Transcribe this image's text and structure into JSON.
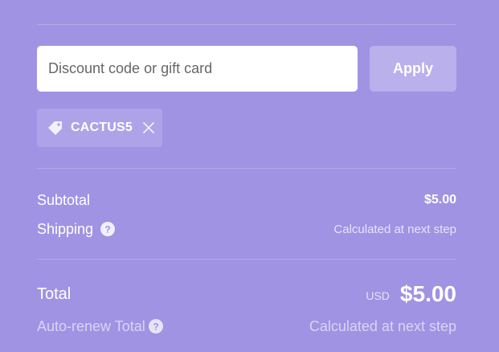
{
  "discount": {
    "placeholder": "Discount code or gift card",
    "value": "",
    "apply_label": "Apply"
  },
  "applied_code": {
    "code": "CACTUS5",
    "icon": "tag-icon",
    "remove_icon": "close-icon"
  },
  "summary": {
    "subtotal_label": "Subtotal",
    "subtotal_value": "$5.00",
    "shipping_label": "Shipping",
    "shipping_value": "Calculated at next step",
    "total_label": "Total",
    "currency": "USD",
    "total_value": "$5.00",
    "autorenew_label": "Auto-renew Total",
    "autorenew_value": "Calculated at next step"
  },
  "colors": {
    "background": "#a093e3",
    "apply_button": "#b9b0ec",
    "tag_background": "#aea3e8"
  }
}
